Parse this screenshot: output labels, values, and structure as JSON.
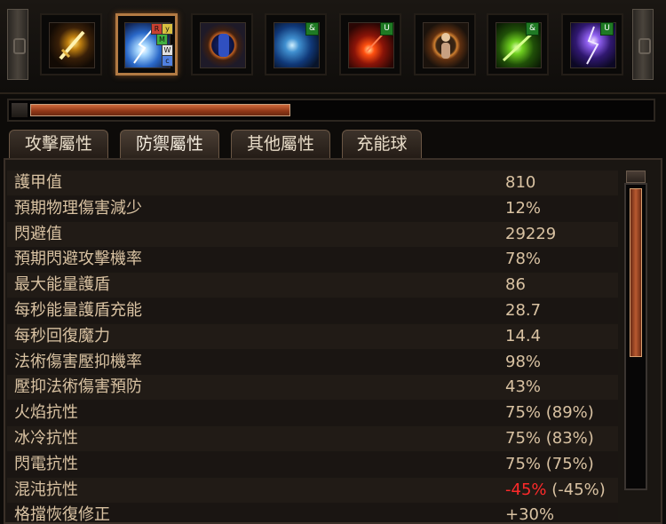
{
  "skill_bar": {
    "slots": [
      {
        "icon": "golden-sword-icon",
        "badge": ""
      },
      {
        "icon": "lightning-storm-icon",
        "badge": "",
        "sockets": [
          "R",
          "y",
          "M",
          "W",
          "c"
        ],
        "active": true
      },
      {
        "icon": "blue-orb-fist-icon",
        "badge": ""
      },
      {
        "icon": "blue-flame-spirit-icon",
        "badge": "&"
      },
      {
        "icon": "fire-meteor-icon",
        "badge": "U"
      },
      {
        "icon": "glowing-figure-icon",
        "badge": ""
      },
      {
        "icon": "green-slash-icon",
        "badge": "&"
      },
      {
        "icon": "purple-lightning-icon",
        "badge": "U"
      }
    ]
  },
  "progress": {
    "value": 0.42
  },
  "tabs": [
    {
      "label": "攻擊屬性"
    },
    {
      "label": "防禦屬性",
      "active": true
    },
    {
      "label": "其他屬性"
    },
    {
      "label": "充能球"
    }
  ],
  "stats": [
    {
      "label": "護甲值",
      "value": "810",
      "value_extra": ""
    },
    {
      "label": "預期物理傷害減少",
      "value": "12%",
      "value_extra": ""
    },
    {
      "label": "閃避值",
      "value": "29229",
      "value_extra": ""
    },
    {
      "label": "預期閃避攻擊機率",
      "value": "78%",
      "value_extra": ""
    },
    {
      "label": "最大能量護盾",
      "value": "86",
      "value_extra": ""
    },
    {
      "label": "每秒能量護盾充能",
      "value": "28.7",
      "value_extra": ""
    },
    {
      "label": "每秒回復魔力",
      "value": "14.4",
      "value_extra": ""
    },
    {
      "label": "法術傷害壓抑機率",
      "value": "98%",
      "value_extra": ""
    },
    {
      "label": "壓抑法術傷害預防",
      "value": "43%",
      "value_extra": ""
    },
    {
      "label": "火焰抗性",
      "value": "75% (89%)",
      "value_extra": ""
    },
    {
      "label": "冰冷抗性",
      "value": "75% (83%)",
      "value_extra": ""
    },
    {
      "label": "閃電抗性",
      "value": "75% (75%)",
      "value_extra": ""
    },
    {
      "label": "混沌抗性",
      "value": "-45%",
      "value_extra": " (-45%)",
      "negative": true
    },
    {
      "label": "格擋恢復修正",
      "value": "+30%",
      "value_extra": ""
    }
  ],
  "scrollbar": {
    "position": 0.0
  }
}
